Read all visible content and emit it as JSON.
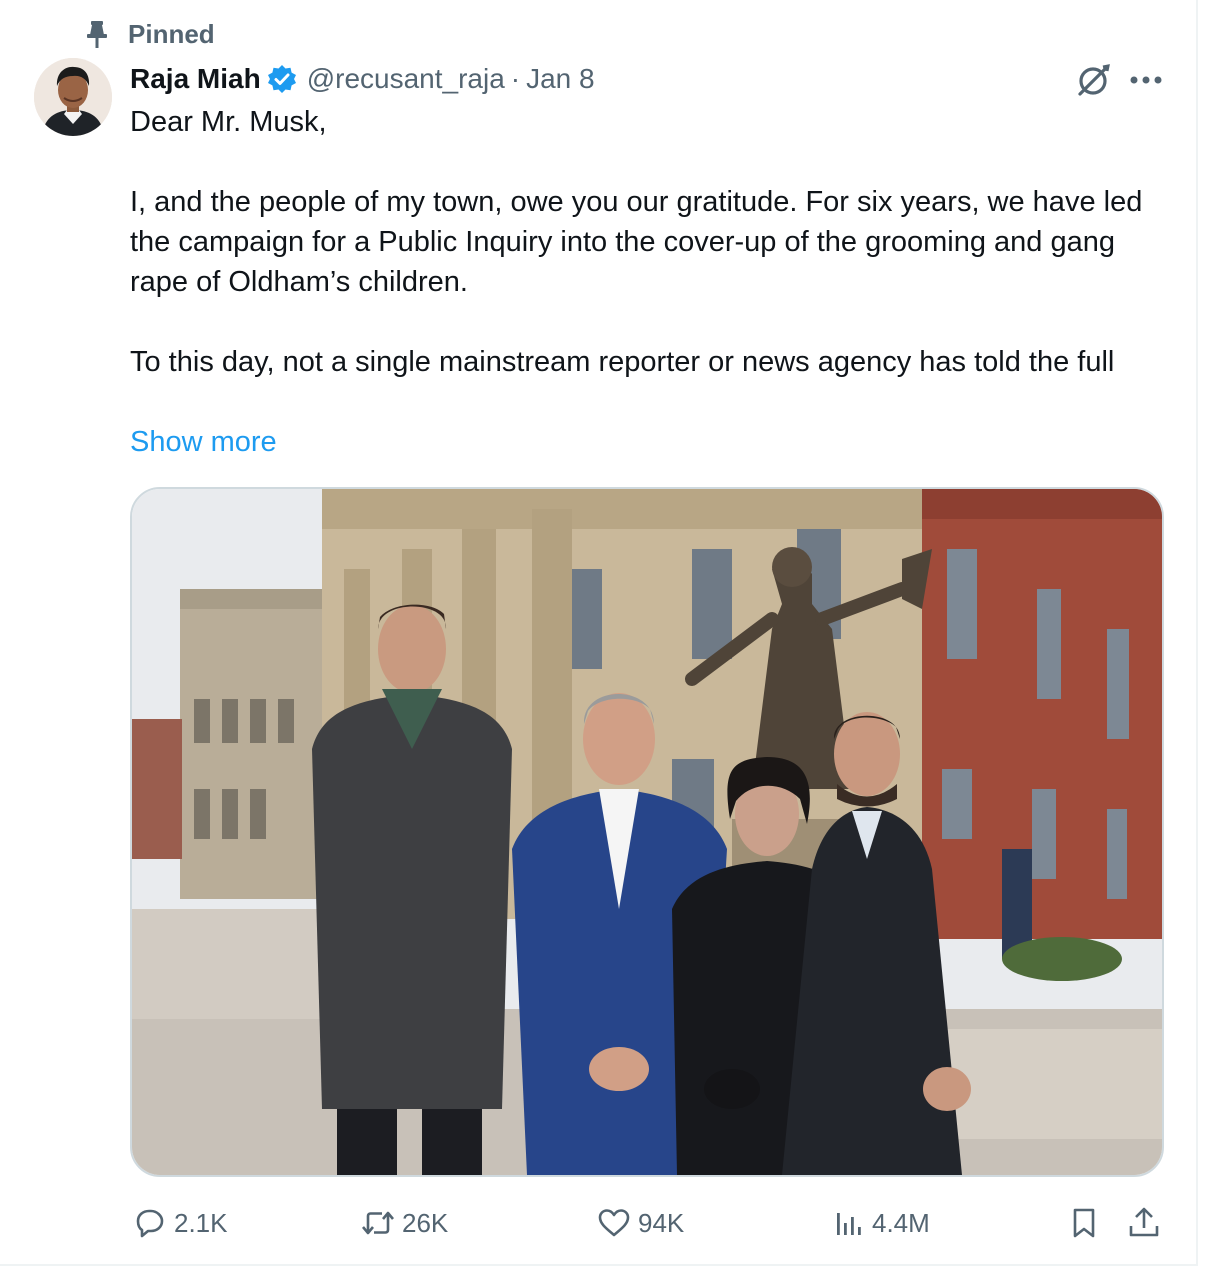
{
  "pinned": {
    "label": "Pinned",
    "icon": "pin-icon"
  },
  "author": {
    "display_name": "Raja Miah",
    "handle": "@recusant_raja",
    "separator": "·",
    "date": "Jan 8",
    "verified": true,
    "avatar_icon": "avatar"
  },
  "tweet": {
    "line1": "Dear Mr. Musk,",
    "para2": "I, and the people of my town, owe you our gratitude. For six years, we have led the campaign for a Public Inquiry into the cover-up of the grooming and gang rape of Oldham’s children.",
    "para3": "To this day, not a single mainstream reporter or news agency has told the full",
    "show_more": "Show more"
  },
  "actions": {
    "reply": {
      "count": "2.1K",
      "icon": "reply-icon"
    },
    "repost": {
      "count": "26K",
      "icon": "repost-icon"
    },
    "like": {
      "count": "94K",
      "icon": "heart-icon"
    },
    "views": {
      "count": "4.4M",
      "icon": "views-icon"
    },
    "bookmark": {
      "icon": "bookmark-icon"
    },
    "share": {
      "icon": "share-icon"
    }
  },
  "colors": {
    "text": "#0f1419",
    "secondary": "#536471",
    "link": "#1d9bf0",
    "verified": "#1d9bf0",
    "border": "#cfd9de"
  }
}
